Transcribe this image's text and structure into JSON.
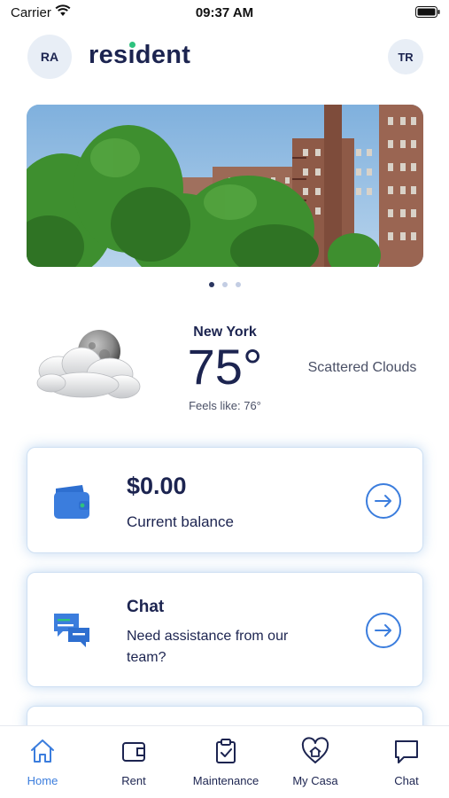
{
  "status_bar": {
    "carrier": "Carrier",
    "time": "09:37 AM"
  },
  "header": {
    "user_initials": "RA",
    "logo_text": "resident",
    "profile_initials": "TR"
  },
  "carousel": {
    "active_index": 0,
    "count": 3
  },
  "weather": {
    "city": "New York",
    "temperature": "75°",
    "feels_like": "Feels like: 76°",
    "condition": "Scattered Clouds",
    "icon": "cloudy-night-icon"
  },
  "cards": {
    "balance": {
      "amount": "$0.00",
      "label": "Current balance",
      "icon": "wallet-icon"
    },
    "chat": {
      "title": "Chat",
      "description": "Need assistance from our team?",
      "icon": "chat-bubbles-icon"
    }
  },
  "tabs": [
    {
      "label": "Home",
      "icon": "home-icon",
      "active": true
    },
    {
      "label": "Rent",
      "icon": "wallet-icon",
      "active": false
    },
    {
      "label": "Maintenance",
      "icon": "clipboard-check-icon",
      "active": false
    },
    {
      "label": "My Casa",
      "icon": "heart-house-icon",
      "active": false
    },
    {
      "label": "Chat",
      "icon": "chat-icon",
      "active": false
    }
  ],
  "colors": {
    "brand": "#1c2450",
    "accent": "#3b7ddd",
    "logo_dot": "#2ec27e"
  }
}
